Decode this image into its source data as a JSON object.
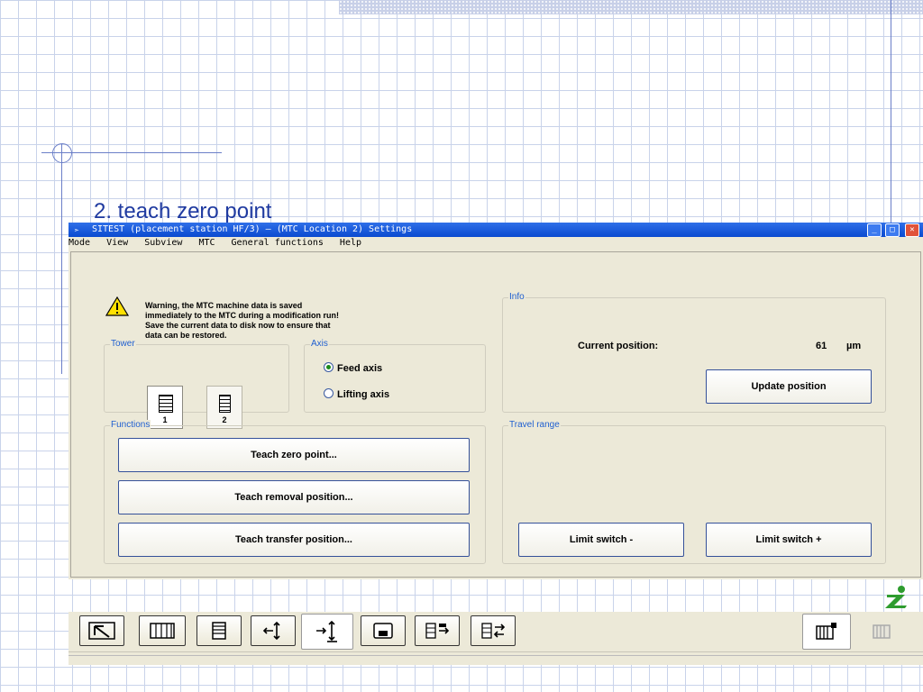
{
  "slide": {
    "title": "2. teach  zero  point"
  },
  "window": {
    "title": "SITEST (placement station HF/3) – (MTC Location 2) Settings",
    "controls": [
      "_",
      "□",
      "✕"
    ]
  },
  "menu": [
    "Mode",
    "View",
    "Subview",
    "MTC",
    "General functions",
    "Help"
  ],
  "warning": {
    "lines": [
      "Warning, the MTC machine data is saved",
      "immediately to the MTC during a modification run!",
      "Save the current data to disk now to ensure that",
      "data can be restored."
    ]
  },
  "tower": {
    "label": "Tower",
    "buttons": [
      "1",
      "2"
    ],
    "selected": "1"
  },
  "axis": {
    "label": "Axis",
    "options": [
      "Feed axis",
      "Lifting axis"
    ],
    "selected": "Feed axis"
  },
  "info": {
    "label": "Info",
    "current_position_label": "Current position:",
    "current_position_value": "61",
    "unit": "µm",
    "update_button": "Update position"
  },
  "functions": {
    "label": "Functions",
    "buttons": [
      "Teach zero point...",
      "Teach removal position...",
      "Teach transfer position..."
    ]
  },
  "travel_range": {
    "label": "Travel range",
    "limit_minus": "Limit switch -",
    "limit_plus": "Limit switch +"
  },
  "colors": {
    "accent": "#1f5fd0",
    "titlebar": "#0a4ad0",
    "panel": "#ece9d8"
  },
  "toolbar_icons": [
    "pointer-icon",
    "table-icon",
    "tower-icon",
    "axis-icon",
    "zero-point-icon",
    "save-icon",
    "removal-icon",
    "transfer-icon",
    "magazine-icon",
    "magazine-disabled-icon",
    "info-icon"
  ]
}
